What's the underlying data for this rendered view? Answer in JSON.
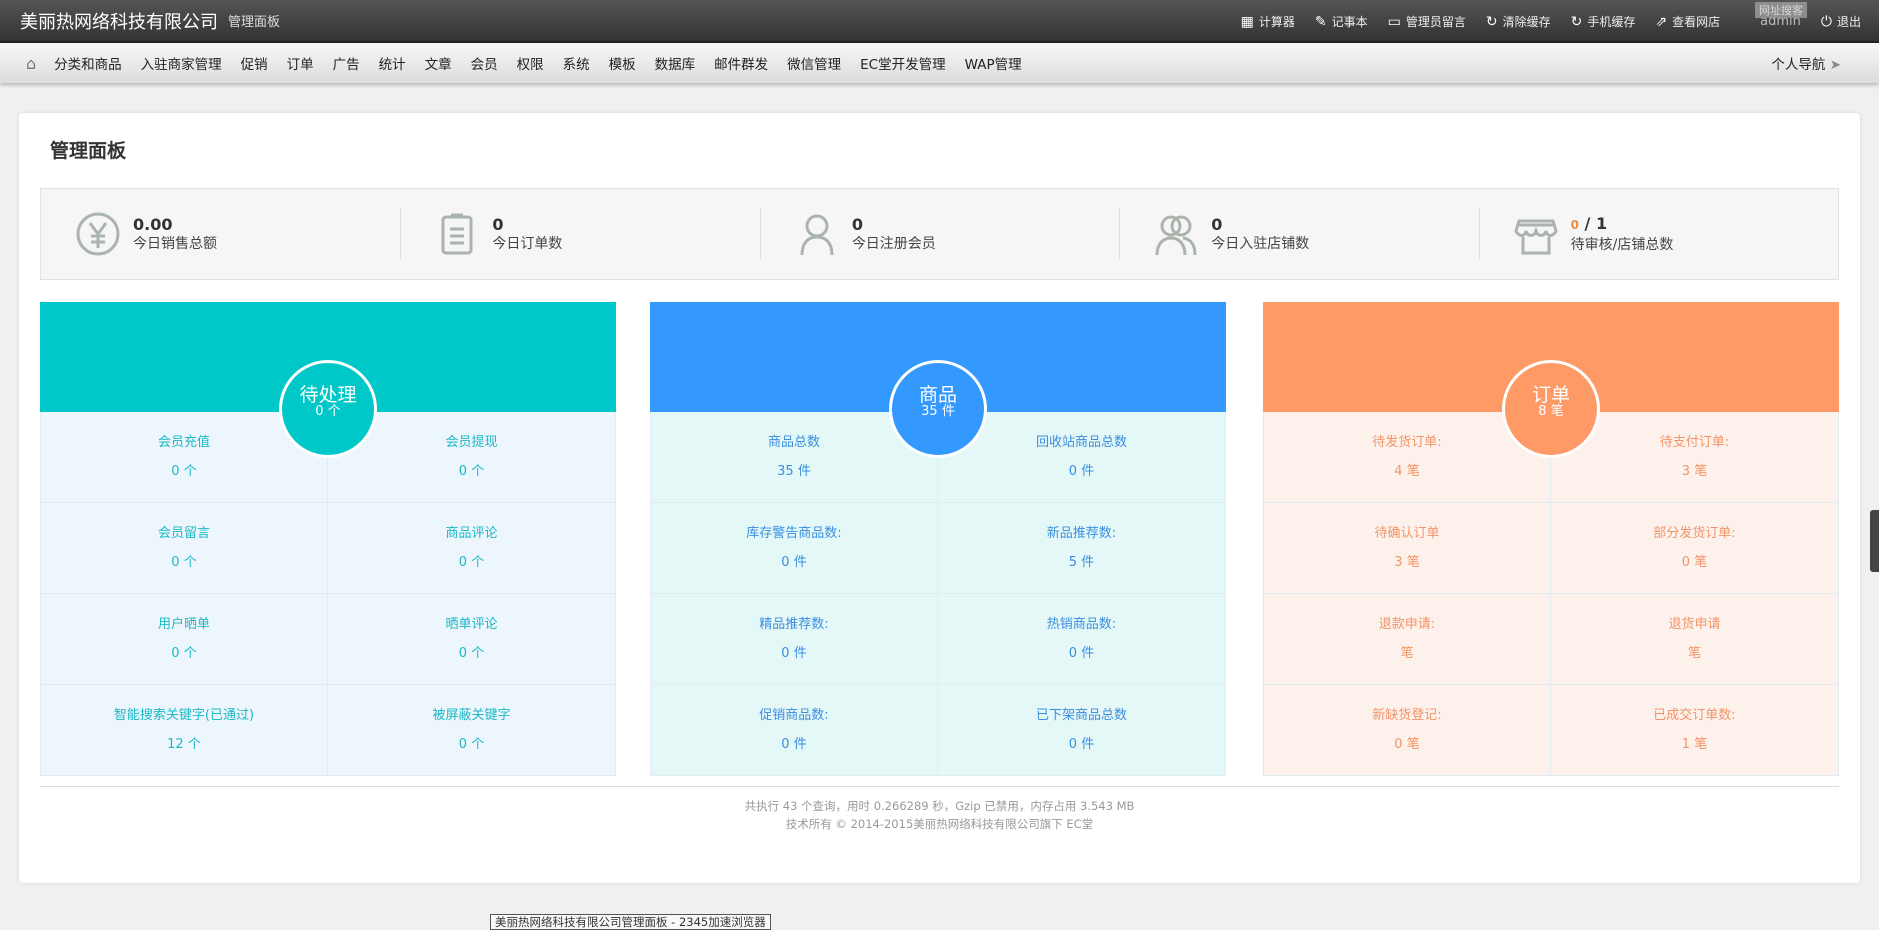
{
  "header": {
    "brand": "美丽热网络科技有限公司",
    "subtitle": "管理面板",
    "links": [
      {
        "icon": "calculator-icon",
        "label": "计算器"
      },
      {
        "icon": "edit-icon",
        "label": "记事本"
      },
      {
        "icon": "comment-icon",
        "label": "管理员留言"
      },
      {
        "icon": "refresh-icon",
        "label": "清除缓存"
      },
      {
        "icon": "refresh-icon",
        "label": "手机缓存"
      },
      {
        "icon": "external-link-icon",
        "label": "查看网店"
      }
    ],
    "user": "admin",
    "logout": "退出",
    "web_badge": "网址搜客"
  },
  "nav": {
    "items": [
      "分类和商品",
      "入驻商家管理",
      "促销",
      "订单",
      "广告",
      "统计",
      "文章",
      "会员",
      "权限",
      "系统",
      "模板",
      "数据库",
      "邮件群发",
      "微信管理",
      "EC堂开发管理",
      "WAP管理"
    ],
    "right": "个人导航"
  },
  "page": {
    "title": "管理面板"
  },
  "stats": [
    {
      "icon": "yen-icon",
      "value": "0.00",
      "label": "今日销售总额"
    },
    {
      "icon": "clipboard-icon",
      "value": "0",
      "label": "今日订单数"
    },
    {
      "icon": "user-icon",
      "value": "0",
      "label": "今日注册会员"
    },
    {
      "icon": "users-icon",
      "value": "0",
      "label": "今日入驻店铺数"
    },
    {
      "icon": "store-icon",
      "value_highlight": "0",
      "value": " / 1",
      "label": "待审核/店铺总数"
    }
  ],
  "panels": [
    {
      "title": "待处理",
      "count": "0 个",
      "color": "#00c8c8",
      "bg": "#eef6fd",
      "text": "#1bb9c5",
      "cells": [
        {
          "label": "会员充值",
          "value": "0 个"
        },
        {
          "label": "会员提现",
          "value": "0 个"
        },
        {
          "label": "会员留言",
          "value": "0 个"
        },
        {
          "label": "商品评论",
          "value": "0 个"
        },
        {
          "label": "用户晒单",
          "value": "0 个"
        },
        {
          "label": "晒单评论",
          "value": "0 个"
        },
        {
          "label": "智能搜索关键字(已通过)",
          "value": "12 个"
        },
        {
          "label": "被屏蔽关键字",
          "value": "0 个"
        }
      ]
    },
    {
      "title": "商品",
      "count": "35 件",
      "color": "#3399ff",
      "bg": "#e5f8f8",
      "text": "#3a8ee0",
      "cells": [
        {
          "label": "商品总数",
          "value": "35 件"
        },
        {
          "label": "回收站商品总数",
          "value": "0 件"
        },
        {
          "label": "库存警告商品数:",
          "value": "0 件"
        },
        {
          "label": "新品推荐数:",
          "value": "5 件"
        },
        {
          "label": "精品推荐数:",
          "value": "0 件"
        },
        {
          "label": "热销商品数:",
          "value": "0 件"
        },
        {
          "label": "促销商品数:",
          "value": "0 件"
        },
        {
          "label": "已下架商品总数",
          "value": "0 件"
        }
      ]
    },
    {
      "title": "订单",
      "count": "8 笔",
      "color": "#ff9966",
      "bg": "#fdf1ec",
      "text": "#f39468",
      "cells": [
        {
          "label": "待发货订单:",
          "value": "4 笔"
        },
        {
          "label": "待支付订单:",
          "value": "3 笔"
        },
        {
          "label": "待确认订单",
          "value": "3 笔"
        },
        {
          "label": "部分发货订单:",
          "value": "0 笔"
        },
        {
          "label": "退款申请:",
          "value": "笔"
        },
        {
          "label": "退货申请",
          "value": "笔"
        },
        {
          "label": "新缺货登记:",
          "value": "0 笔"
        },
        {
          "label": "已成交订单数:",
          "value": "1 笔"
        }
      ]
    }
  ],
  "footer": {
    "line1": "共执行 43 个查询，用时 0.266289 秒，Gzip 已禁用，内存占用 3.543 MB",
    "line2": "技术所有 © 2014-2015美丽热网络科技有限公司旗下 EC堂"
  },
  "tooltip": "美丽热网络科技有限公司管理面板 - 2345加速浏览器"
}
